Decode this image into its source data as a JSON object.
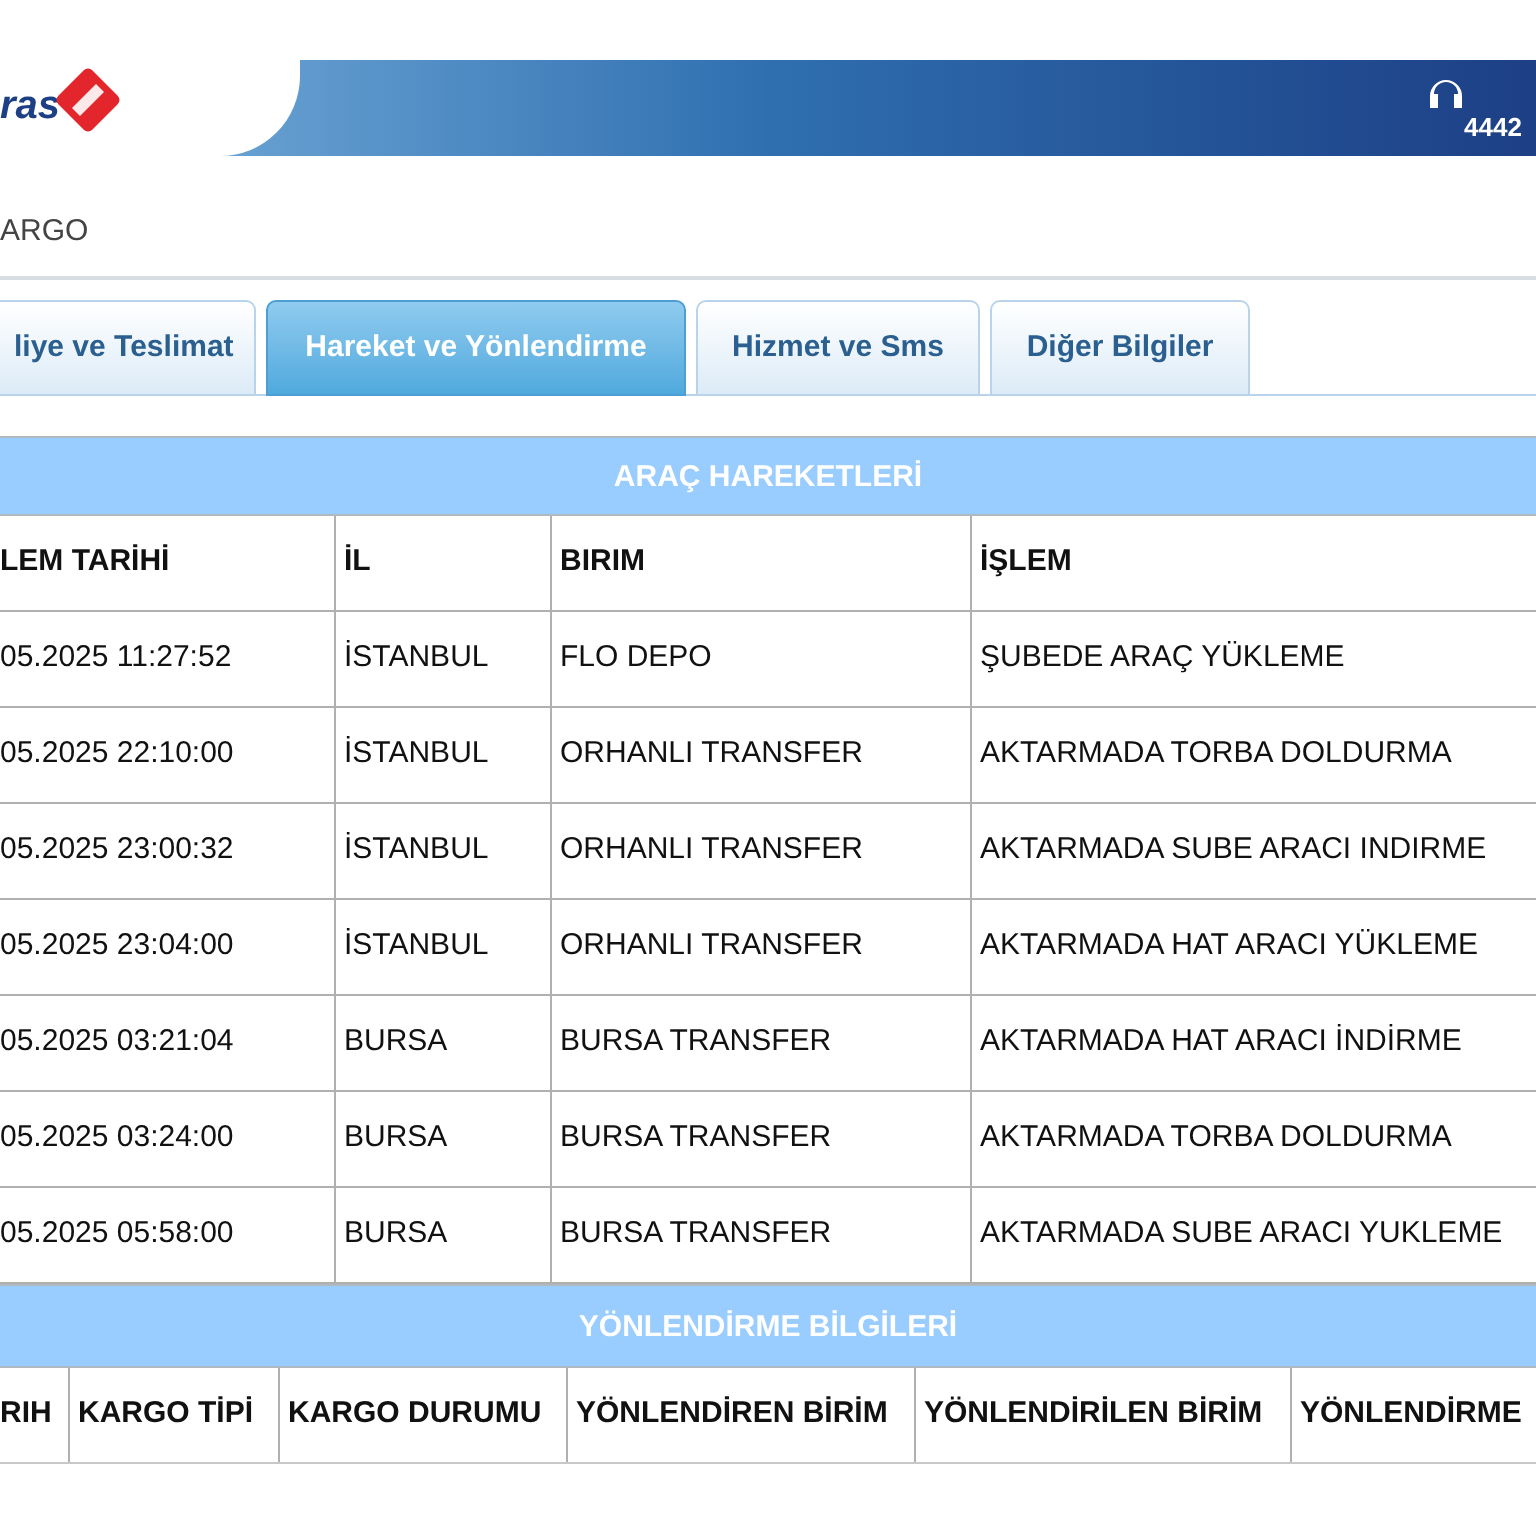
{
  "header": {
    "logo_text": "ras",
    "phone": "4442"
  },
  "breadcrumb": "ARGO",
  "tabs": [
    {
      "label": "liye ve Teslimat",
      "selected": false
    },
    {
      "label": "Hareket ve Yönlendirme",
      "selected": true
    },
    {
      "label": "Hizmet ve Sms",
      "selected": false
    },
    {
      "label": "Diğer Bilgiler",
      "selected": false
    }
  ],
  "movements": {
    "title": "ARAÇ HAREKETLERİ",
    "columns": [
      "LEM TARİHİ",
      "İL",
      "BIRIM",
      "İŞLEM"
    ],
    "rows": [
      [
        "05.2025 11:27:52",
        "İSTANBUL",
        "FLO DEPO",
        "ŞUBEDE ARAÇ YÜKLEME"
      ],
      [
        "05.2025 22:10:00",
        "İSTANBUL",
        "ORHANLI TRANSFER",
        "AKTARMADA TORBA DOLDURMA"
      ],
      [
        "05.2025 23:00:32",
        "İSTANBUL",
        "ORHANLI TRANSFER",
        "AKTARMADA SUBE ARACI INDIRME"
      ],
      [
        "05.2025 23:04:00",
        "İSTANBUL",
        "ORHANLI TRANSFER",
        "AKTARMADA HAT ARACI YÜKLEME"
      ],
      [
        "05.2025 03:21:04",
        "BURSA",
        "BURSA TRANSFER",
        "AKTARMADA HAT ARACI İNDİRME"
      ],
      [
        "05.2025 03:24:00",
        "BURSA",
        "BURSA TRANSFER",
        "AKTARMADA TORBA DOLDURMA"
      ],
      [
        "05.2025 05:58:00",
        "BURSA",
        "BURSA TRANSFER",
        "AKTARMADA SUBE ARACI YUKLEME"
      ]
    ]
  },
  "routing": {
    "title": "YÖNLENDİRME BİLGİLERİ",
    "columns": [
      "RIH",
      "KARGO TİPİ",
      "KARGO DURUMU",
      "YÖNLENDİREN BİRİM",
      "YÖNLENDİRİLEN BİRİM",
      "YÖNLENDİRME"
    ]
  }
}
